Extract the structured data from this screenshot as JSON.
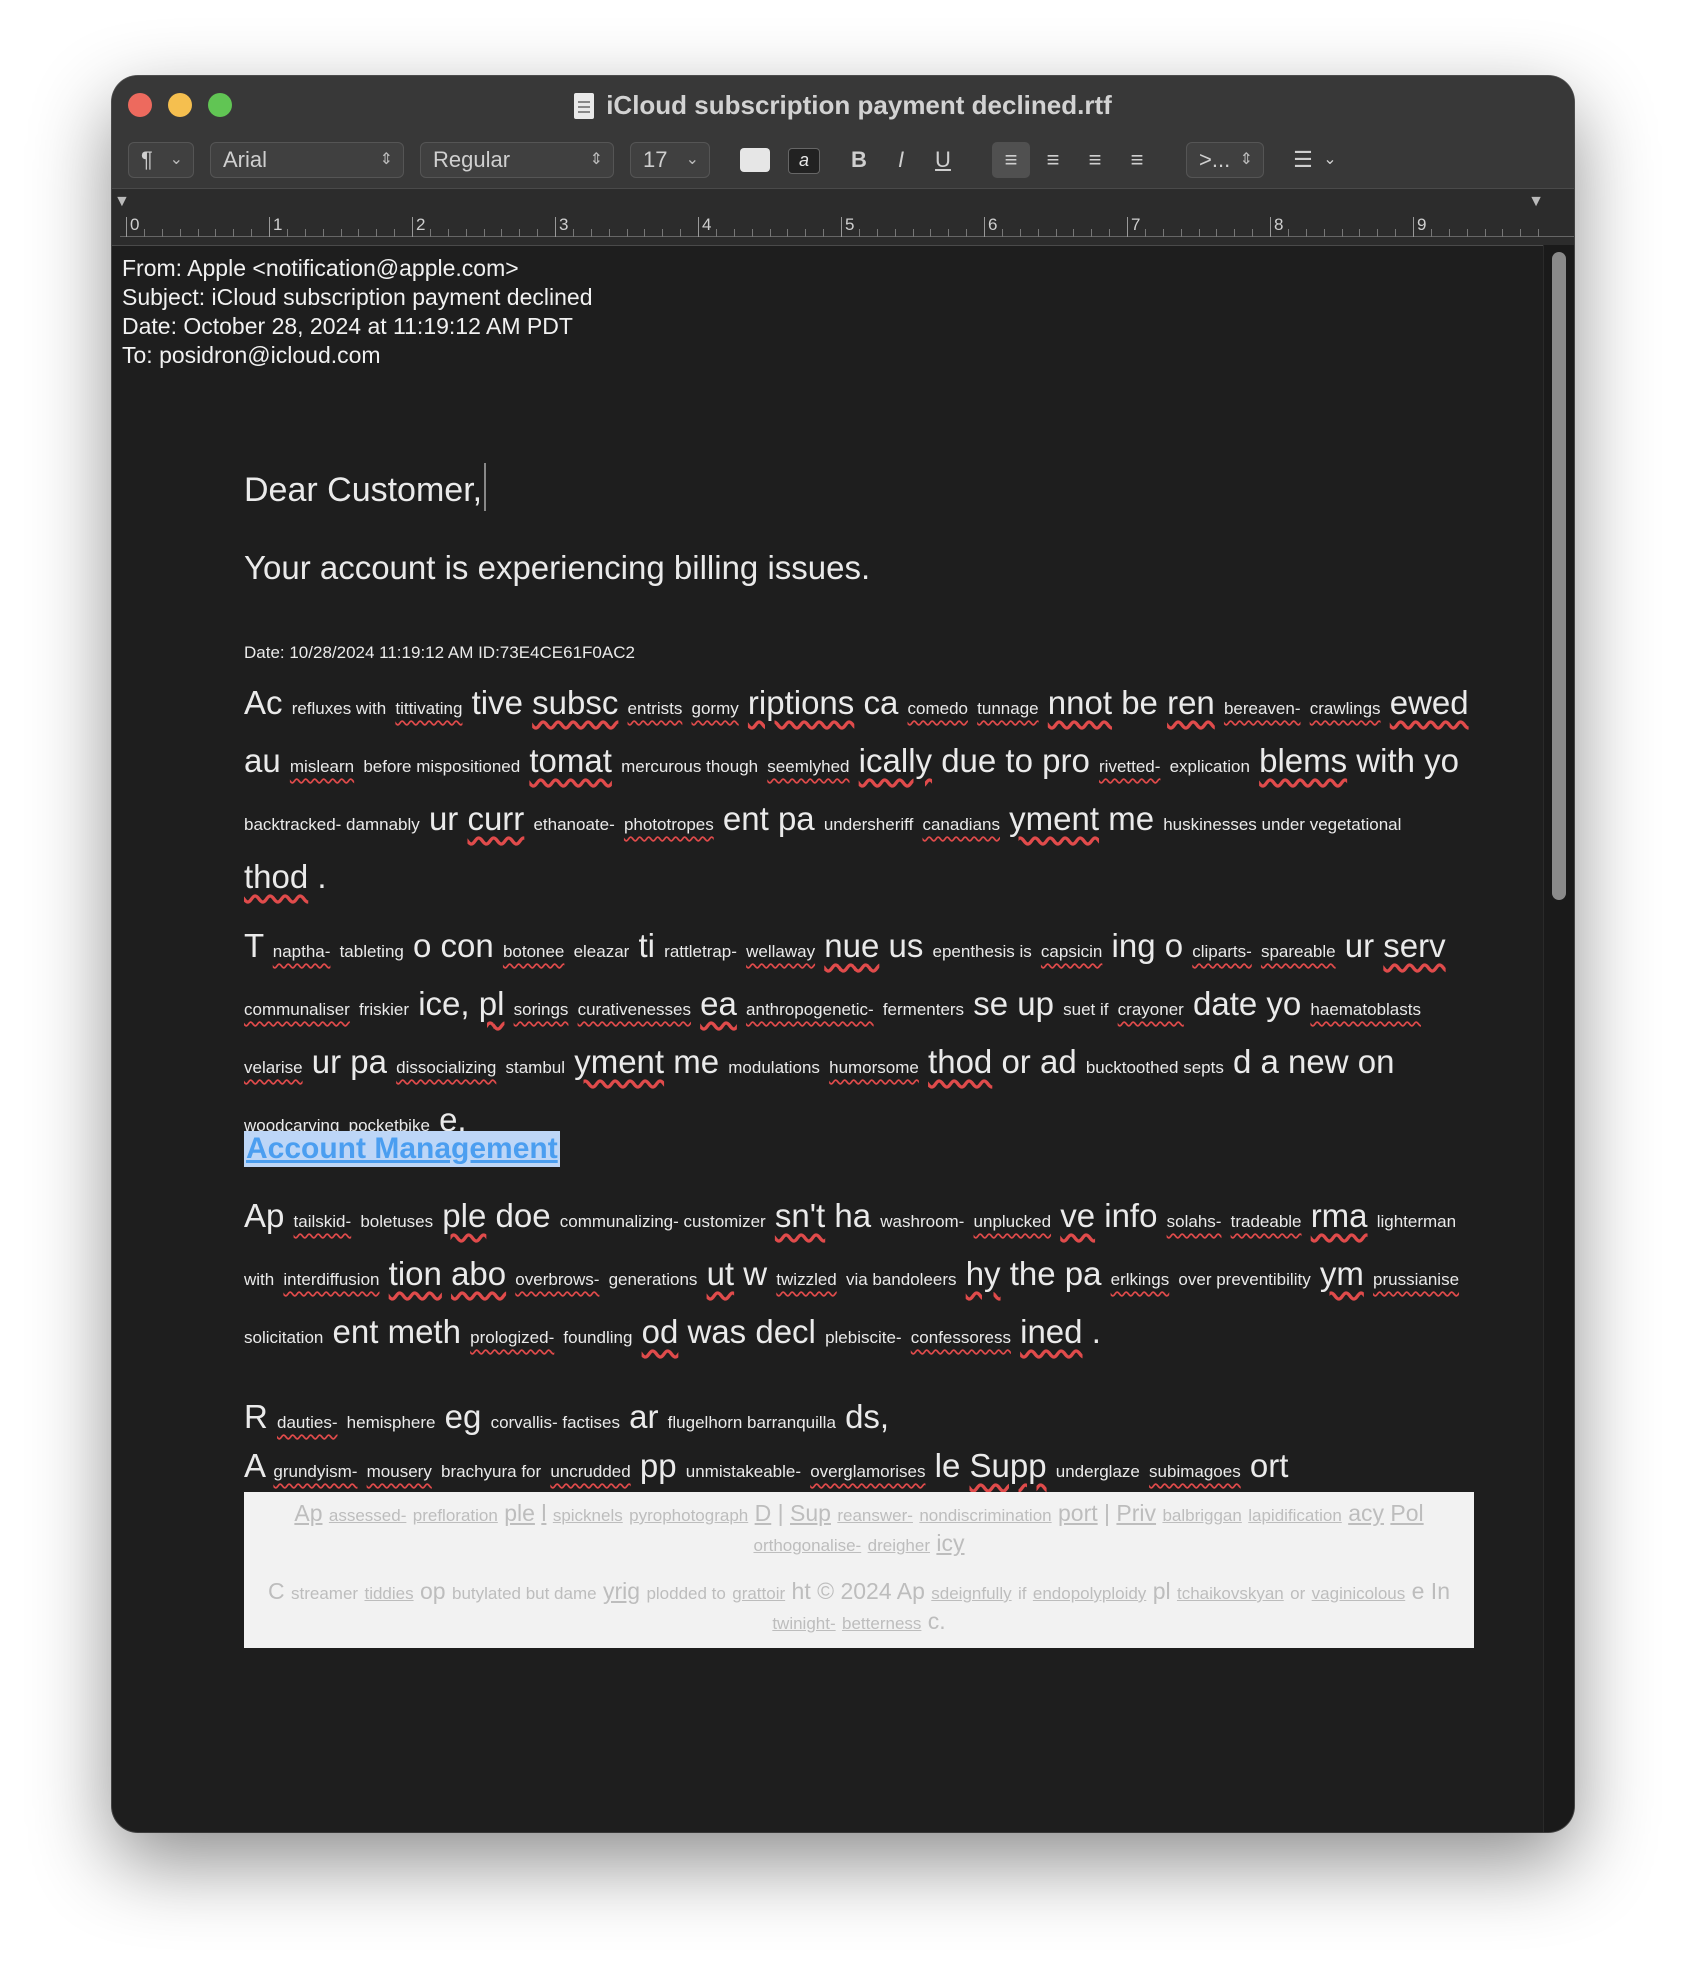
{
  "window": {
    "title": "iCloud subscription payment declined.rtf"
  },
  "toolbar": {
    "paragraph_symbol": "¶",
    "font_family": "Arial",
    "font_style": "Regular",
    "font_size": "17",
    "bold": "B",
    "italic": "I",
    "underline": "U",
    "list_spacing": ">...",
    "colors": {
      "text": "#e6e6e6",
      "highlight": "#222222"
    }
  },
  "ruler": {
    "labels": [
      "0",
      "1",
      "2",
      "3",
      "4",
      "5",
      "6",
      "7",
      "8",
      "9"
    ]
  },
  "header": {
    "from": "From: Apple <notification@apple.com>",
    "subject": "Subject: iCloud subscription payment declined",
    "date": "Date: October 28, 2024 at 11:19:12 AM PDT",
    "to": "To: posidron@icloud.com"
  },
  "body": {
    "greeting": "Dear Customer,",
    "lead": "Your account is experiencing billing issues.",
    "dateline": "Date: 10/28/2024 11:19:12 AM ID:73E4CE61F0AC2",
    "p1": [
      [
        "Ac",
        "L"
      ],
      [
        "refluxes with",
        "S"
      ],
      [
        "tittivating",
        "SU"
      ],
      [
        "tive",
        "L"
      ],
      [
        "subsc",
        "LU"
      ],
      [
        "entrists",
        "SU"
      ],
      [
        "gormy",
        "SU"
      ],
      [
        "riptions",
        "LU"
      ],
      [
        "ca",
        "L"
      ],
      [
        "comedo",
        "SU"
      ],
      [
        "tunnage",
        "SU"
      ],
      [
        "nnot",
        "LU"
      ],
      [
        "be",
        "L"
      ],
      [
        "ren",
        "LU"
      ],
      [
        "bereaven-",
        "SU"
      ],
      [
        "crawlings",
        "SU"
      ],
      [
        "ewed",
        "LU"
      ],
      [
        "au",
        "L"
      ],
      [
        "mislearn",
        "SU"
      ],
      [
        "before mispositioned",
        "S"
      ],
      [
        "tomat",
        "LU"
      ],
      [
        "mercurous though",
        "S"
      ],
      [
        "seemlyhed",
        "SU"
      ],
      [
        "ically",
        "LU"
      ],
      [
        "due to pro",
        "L"
      ],
      [
        "rivetted-",
        "SU"
      ],
      [
        "explication",
        "S"
      ],
      [
        "blems",
        "LU"
      ],
      [
        "with yo",
        "L"
      ],
      [
        "backtracked- damnably",
        "S"
      ],
      [
        "ur",
        "L"
      ],
      [
        "curr",
        "LU"
      ],
      [
        "ethanoate-",
        "S"
      ],
      [
        "phototropes",
        "SU"
      ],
      [
        "ent pa",
        "L"
      ],
      [
        "undersheriff",
        "S"
      ],
      [
        "canadians",
        "SU"
      ],
      [
        "yment",
        "LU"
      ],
      [
        "me",
        "L"
      ],
      [
        "huskinesses under vegetational",
        "S"
      ],
      [
        "thod",
        "LU"
      ],
      [
        ".",
        "L"
      ]
    ],
    "p2": [
      [
        "T",
        "L"
      ],
      [
        "naptha-",
        "SU"
      ],
      [
        "tableting",
        "S"
      ],
      [
        "o con",
        "L"
      ],
      [
        "botonee",
        "SU"
      ],
      [
        "eleazar",
        "S"
      ],
      [
        "ti",
        "L"
      ],
      [
        "rattletrap-",
        "S"
      ],
      [
        "wellaway",
        "SU"
      ],
      [
        "nue",
        "LU"
      ],
      [
        "us",
        "L"
      ],
      [
        "epenthesis is",
        "S"
      ],
      [
        "capsicin",
        "SU"
      ],
      [
        "ing o",
        "L"
      ],
      [
        "cliparts-",
        "SU"
      ],
      [
        "spareable",
        "SU"
      ],
      [
        "ur",
        "L"
      ],
      [
        "serv",
        "LU"
      ],
      [
        "communaliser",
        "SU"
      ],
      [
        "friskier",
        "S"
      ],
      [
        "ice,",
        "L"
      ],
      [
        "pl",
        "LU"
      ],
      [
        "sorings",
        "SU"
      ],
      [
        "curativenesses",
        "SU"
      ],
      [
        "ea",
        "LU"
      ],
      [
        "anthropogenetic-",
        "SU"
      ],
      [
        "fermenters",
        "S"
      ],
      [
        "se up",
        "L"
      ],
      [
        "suet if",
        "S"
      ],
      [
        "crayoner",
        "SU"
      ],
      [
        "date yo",
        "L"
      ],
      [
        "haematoblasts",
        "SU"
      ],
      [
        "velarise",
        "SU"
      ],
      [
        "ur pa",
        "L"
      ],
      [
        "dissocializing",
        "SU"
      ],
      [
        "stambul",
        "S"
      ],
      [
        "yment",
        "LU"
      ],
      [
        "me",
        "L"
      ],
      [
        "modulations",
        "S"
      ],
      [
        "humorsome",
        "SU"
      ],
      [
        "thod",
        "LU"
      ],
      [
        "or ad",
        "L"
      ],
      [
        "bucktoothed septs",
        "S"
      ],
      [
        "d a new on",
        "L"
      ],
      [
        "woodcarving",
        "S"
      ],
      [
        "pocketbike",
        "SU"
      ],
      [
        "e.",
        "L"
      ]
    ],
    "link": "Account Management",
    "p3": [
      [
        "Ap",
        "L"
      ],
      [
        "tailskid-",
        "SU"
      ],
      [
        "boletuses",
        "S"
      ],
      [
        "ple",
        "LU"
      ],
      [
        "doe",
        "L"
      ],
      [
        "communalizing- customizer",
        "S"
      ],
      [
        "sn't",
        "LU"
      ],
      [
        "ha",
        "L"
      ],
      [
        "washroom-",
        "S"
      ],
      [
        "unplucked",
        "SU"
      ],
      [
        "ve",
        "LU"
      ],
      [
        "info",
        "L"
      ],
      [
        "solahs-",
        "SU"
      ],
      [
        "tradeable",
        "SU"
      ],
      [
        "rma",
        "LU"
      ],
      [
        "lighterman",
        "S"
      ],
      [
        "with",
        "S"
      ],
      [
        "interdiffusion",
        "SU"
      ],
      [
        "tion",
        "LU"
      ],
      [
        "abo",
        "LU"
      ],
      [
        "overbrows-",
        "SU"
      ],
      [
        "generations",
        "S"
      ],
      [
        "ut",
        "LU"
      ],
      [
        "w",
        "L"
      ],
      [
        "twizzled",
        "SU"
      ],
      [
        "via bandoleers",
        "S"
      ],
      [
        "hy",
        "LU"
      ],
      [
        "the pa",
        "L"
      ],
      [
        "erlkings",
        "SU"
      ],
      [
        "over preventibility",
        "S"
      ],
      [
        "ym",
        "LU"
      ],
      [
        "prussianise",
        "SU"
      ],
      [
        "solicitation",
        "S"
      ],
      [
        "ent meth",
        "L"
      ],
      [
        "prologized-",
        "SU"
      ],
      [
        "foundling",
        "S"
      ],
      [
        "od",
        "LU"
      ],
      [
        "was decl",
        "L"
      ],
      [
        "plebiscite-",
        "S"
      ],
      [
        "confessoress",
        "SU"
      ],
      [
        "ined",
        "LU"
      ],
      [
        ".",
        "L"
      ]
    ],
    "p4_line1": [
      [
        "R",
        "L"
      ],
      [
        "dauties-",
        "SU"
      ],
      [
        "hemisphere",
        "S"
      ],
      [
        "eg",
        "L"
      ],
      [
        "corvallis- factises",
        "S"
      ],
      [
        "ar",
        "L"
      ],
      [
        "flugelhorn barranquilla",
        "S"
      ],
      [
        "ds,",
        "L"
      ]
    ],
    "p4_line2": [
      [
        "A",
        "L"
      ],
      [
        "grundyism-",
        "SU"
      ],
      [
        "mousery",
        "SU"
      ],
      [
        "brachyura for",
        "S"
      ],
      [
        "uncrudded",
        "SU"
      ],
      [
        "pp",
        "L"
      ],
      [
        "unmistakeable-",
        "S"
      ],
      [
        "overglamorises",
        "SU"
      ],
      [
        "le",
        "L"
      ],
      [
        "Supp",
        "LU"
      ],
      [
        "underglaze",
        "S"
      ],
      [
        "subimagoes",
        "SU"
      ],
      [
        "ort",
        "L"
      ]
    ]
  },
  "footer": {
    "line1": [
      [
        "Ap",
        "LU"
      ],
      [
        "assessed-",
        "SU"
      ],
      [
        "prefloration",
        "SU"
      ],
      [
        "ple",
        "LU"
      ],
      [
        "l",
        "LU"
      ],
      [
        "spicknels",
        "SU"
      ],
      [
        "pyrophotograph",
        "SU"
      ],
      [
        "D",
        "LU"
      ],
      [
        "|",
        "L"
      ],
      [
        "Sup",
        "LU"
      ],
      [
        "reanswer-",
        "SU"
      ],
      [
        "nondiscrimination",
        "SU"
      ],
      [
        "port",
        "LU"
      ],
      [
        "|",
        "L"
      ],
      [
        "Priv",
        "LU"
      ],
      [
        "balbriggan",
        "SU"
      ],
      [
        "lapidification",
        "SU"
      ],
      [
        "acy",
        "LU"
      ],
      [
        "Pol",
        "LU"
      ]
    ],
    "line2": [
      [
        "orthogonalise-",
        "SU"
      ],
      [
        "dreigher",
        "SU"
      ],
      [
        "icy",
        "LU"
      ]
    ],
    "line3": [
      [
        "C",
        "L"
      ],
      [
        "streamer",
        "S"
      ],
      [
        "tiddies",
        "SU"
      ],
      [
        "op",
        "L"
      ],
      [
        "butylated but dame",
        "S"
      ],
      [
        "yrig",
        "LU"
      ],
      [
        "plodded to",
        "S"
      ],
      [
        "grattoir",
        "SU"
      ],
      [
        "ht © 2024 Ap",
        "L"
      ],
      [
        "sdeignfully",
        "SU"
      ],
      [
        "if",
        "S"
      ],
      [
        "endopolyploidy",
        "SU"
      ],
      [
        "pl",
        "L"
      ],
      [
        "tchaikovskyan",
        "SU"
      ],
      [
        "or",
        "S"
      ],
      [
        "vaginicolous",
        "SU"
      ],
      [
        "e In",
        "L"
      ]
    ],
    "line4": [
      [
        "twinight-",
        "SU"
      ],
      [
        "betterness",
        "SU"
      ],
      [
        "c.",
        "L"
      ]
    ]
  }
}
